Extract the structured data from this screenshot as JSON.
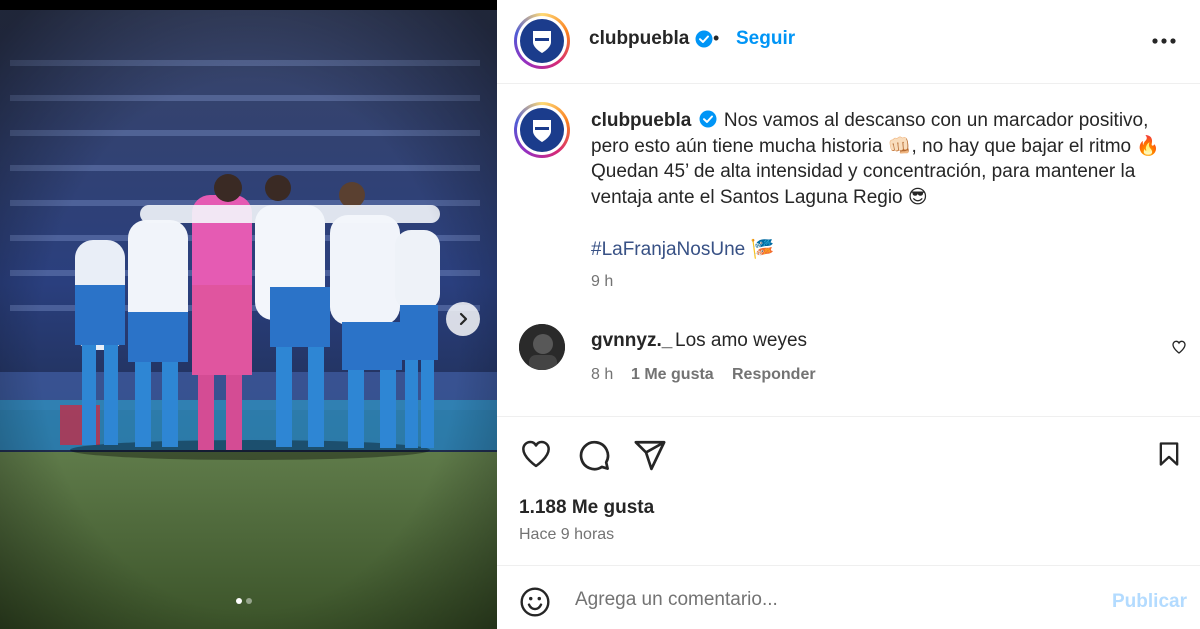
{
  "post": {
    "username": "clubpuebla",
    "follow_label": "Seguir",
    "separator": "•",
    "caption": "Nos vamos al descanso con un marcador positivo, pero esto aún tiene mucha historia 👊🏻, no hay que bajar el ritmo 🔥 Quedan 45’ de alta intensidad y concentración, para mantener la ventaja ante el Santos Laguna Regio 😎",
    "hashtag": "#LaFranjaNosUne 🎏",
    "time": "9 h",
    "likes": "1.188 Me gusta",
    "ago": "Hace 9 horas"
  },
  "comment": {
    "username": "gvnnyz._",
    "text": "Los amo weyes",
    "time": "8 h",
    "likes": "1 Me gusta",
    "reply_label": "Responder"
  },
  "composer": {
    "placeholder": "Agrega un comentario...",
    "publish_label": "Publicar"
  },
  "carousel": {
    "slide_count": 2,
    "active_slide": 1
  },
  "colors": {
    "accent": "#0095f6",
    "publish_disabled": "#b3dbff",
    "hashtag": "#385185",
    "muted": "#737373",
    "verified": "#0095f6",
    "club_blue": "#1b3c8c"
  },
  "icons": [
    "verified-badge-icon",
    "more-options-icon",
    "chevron-right-icon",
    "heart-icon",
    "comment-icon",
    "share-icon",
    "save-icon",
    "emoji-icon"
  ]
}
